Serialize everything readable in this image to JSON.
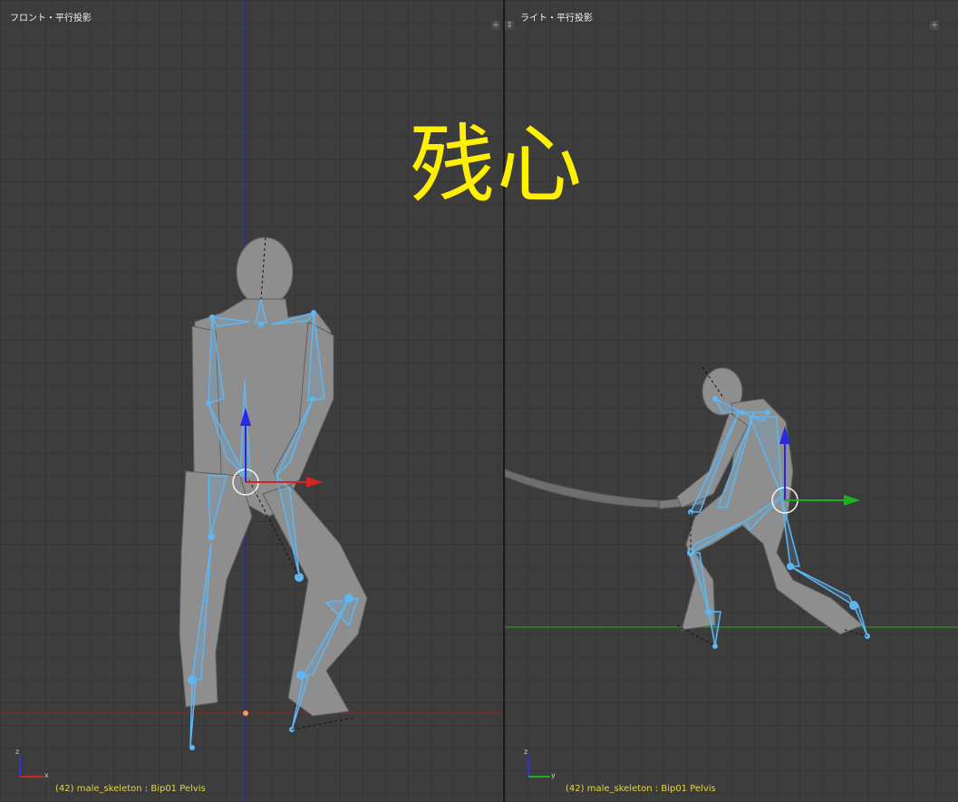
{
  "viewports": {
    "front": {
      "title": "フロント・平行投影",
      "status": "(42) male_skeleton : Bip01 Pelvis",
      "axis_z": "z",
      "axis_x": "x"
    },
    "right": {
      "title": "ライト・平行投影",
      "status": "(42) male_skeleton : Bip01 Pelvis",
      "axis_z": "z",
      "axis_y": "y"
    }
  },
  "overlay": {
    "text": "残心"
  },
  "icons": {
    "corner_plus": "+",
    "corner_split": "⇕"
  },
  "colors": {
    "viewport_bg": "#3d3d3d",
    "bone": "#5fb6f0",
    "x_axis": "#d42424",
    "y_axis": "#1faa1f",
    "z_axis": "#1a1ad8",
    "status_text": "#e4d54a",
    "overlay_text": "#ffef00"
  }
}
